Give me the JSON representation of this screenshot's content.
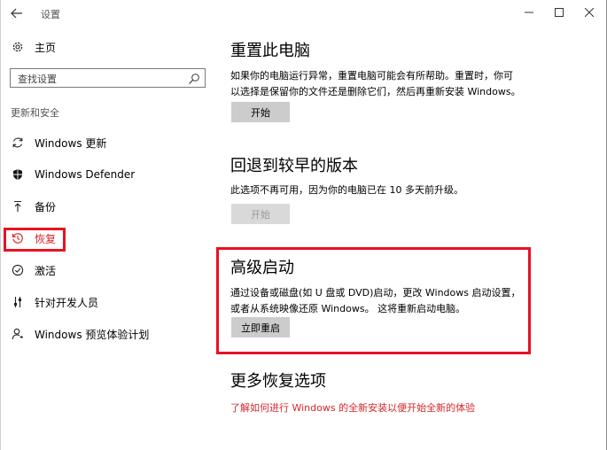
{
  "window": {
    "title": "设置",
    "controls": {
      "minimize": "—",
      "maximize": "☐",
      "close": "✕"
    }
  },
  "sidebar": {
    "home": {
      "label": "主页",
      "icon": "gear-icon"
    },
    "search": {
      "placeholder": "查找设置",
      "icon": "search-icon"
    },
    "section_label": "更新和安全",
    "items": [
      {
        "label": "Windows 更新",
        "icon": "sync-icon",
        "active": false
      },
      {
        "label": "Windows Defender",
        "icon": "shield-icon",
        "active": false
      },
      {
        "label": "备份",
        "icon": "backup-arrow-icon",
        "active": false
      },
      {
        "label": "恢复",
        "icon": "history-icon",
        "active": true
      },
      {
        "label": "激活",
        "icon": "check-circle-icon",
        "active": false
      },
      {
        "label": "针对开发人员",
        "icon": "developer-sliders-icon",
        "active": false
      },
      {
        "label": "Windows 预览体验计划",
        "icon": "person-icon",
        "active": false
      }
    ]
  },
  "main": {
    "reset": {
      "title": "重置此电脑",
      "description_line1": "如果你的电脑运行异常，重置电脑可能会有所帮助。重置时，你可",
      "description_line2": "以选择是保留你的文件还是删除它们，然后再重新安装 Windows。",
      "button": "开始"
    },
    "rollback": {
      "title": "回退到较早的版本",
      "description": "此选项不再可用，因为你的电脑已在 10 多天前升级。",
      "button": "开始"
    },
    "advanced": {
      "title": "高级启动",
      "description_line1": "通过设备或磁盘(如 U 盘或 DVD)启动，更改 Windows 启动设置，",
      "description_line2": "或者从系统映像还原 Windows。 这将重新启动电脑。",
      "button": "立即重启"
    },
    "more": {
      "title": "更多恢复选项",
      "link": "了解如何进行 Windows 的全新安装以便开始全新的体验"
    }
  },
  "colors": {
    "accent": "#d6262b",
    "highlight_border": "#e81123",
    "button_bg": "#cccccc"
  }
}
